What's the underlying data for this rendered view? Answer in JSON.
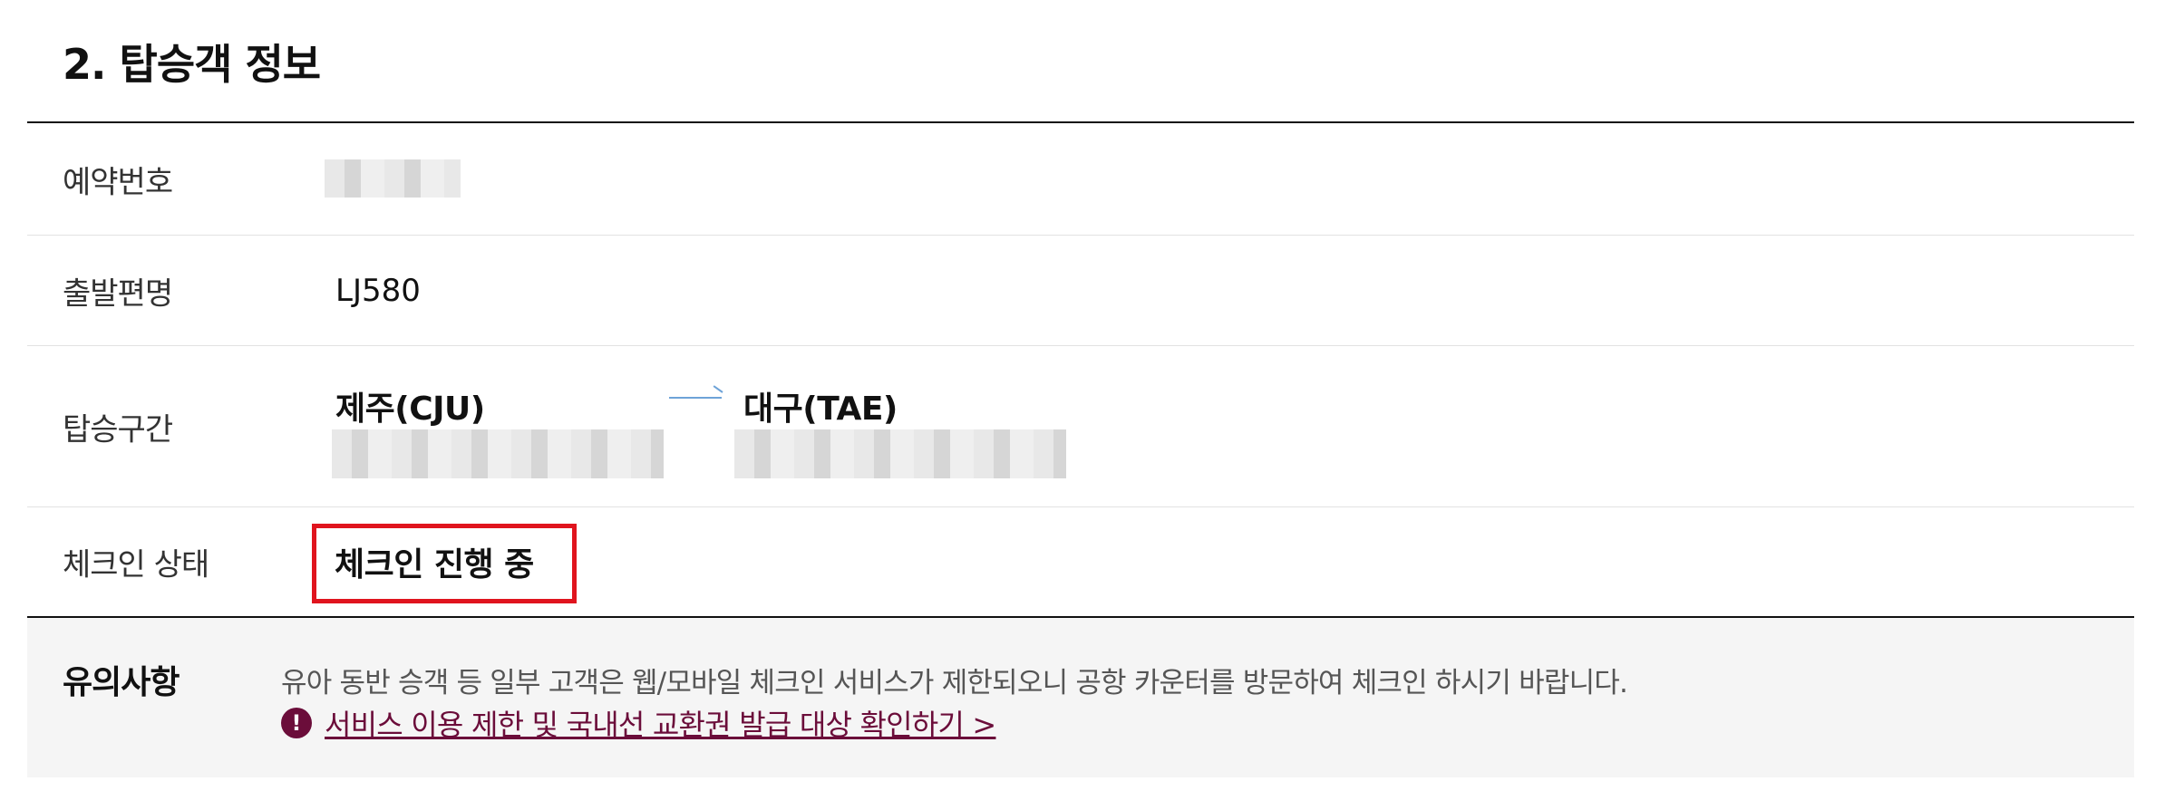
{
  "section": {
    "title": "2. 탑승객 정보"
  },
  "rows": {
    "reservation": {
      "label": "예약번호",
      "value": ""
    },
    "flight": {
      "label": "출발편명",
      "value": "LJ580"
    },
    "route": {
      "label": "탑승구간",
      "from": "제주(CJU)",
      "to": "대구(TAE)",
      "arrow_icon": "arrow-right-icon"
    },
    "status": {
      "label": "체크인 상태",
      "value": "체크인 진행 중",
      "highlight_color": "#e0141e"
    }
  },
  "notice": {
    "title": "유의사항",
    "text": "유아 동반 승객 등 일부 고객은 웹/모바일 체크인 서비스가 제한되오니 공항 카운터를 방문하여 체크인 하시기 바랍니다.",
    "link_label": "서비스 이용 제한 및 국내선 교환권 발급 대상 확인하기 >",
    "icon": "exclamation-circle-icon",
    "icon_glyph": "!",
    "accent_color": "#6b0d3a"
  }
}
